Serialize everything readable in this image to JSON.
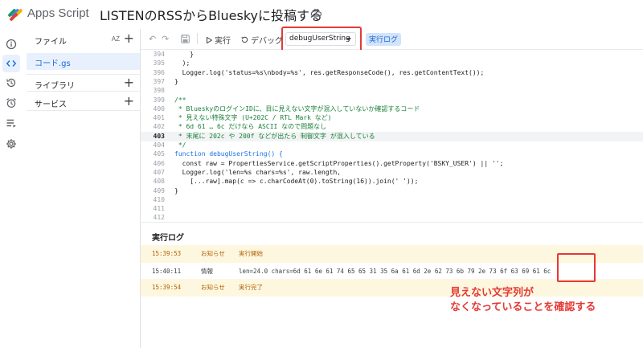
{
  "header": {
    "app_name": "Apps Script",
    "project_title": "LISTENのRSSからBlueskyに投稿する"
  },
  "rail": {
    "items": [
      {
        "icon": "info-icon"
      },
      {
        "icon": "code-icon",
        "active": true
      },
      {
        "icon": "history-icon"
      },
      {
        "icon": "alarm-icon"
      },
      {
        "icon": "executions-icon"
      },
      {
        "icon": "settings-icon"
      }
    ]
  },
  "panel": {
    "files_label": "ファイル",
    "sort_label": "AZ",
    "file_name": "コード.gs",
    "libraries_label": "ライブラリ",
    "services_label": "サービス",
    "plus": "+"
  },
  "toolbar": {
    "run_label": "実行",
    "debug_label": "デバッグ",
    "function_selected": "debugUserString",
    "log_toggle_label": "実行ログ"
  },
  "code_lines": [
    {
      "num": "394",
      "text": "    }",
      "cls": ""
    },
    {
      "num": "395",
      "text": "  );",
      "cls": ""
    },
    {
      "num": "396",
      "text": "  Logger.log('status=%s\\nbody=%s', res.getResponseCode(), res.getContentText());",
      "cls": ""
    },
    {
      "num": "397",
      "text": "}",
      "cls": ""
    },
    {
      "num": "398",
      "text": "",
      "cls": ""
    },
    {
      "num": "399",
      "text": "/**",
      "cls": "comment"
    },
    {
      "num": "400",
      "text": " * BlueskyのログインIDに、目に見えない文字が混入していないか確認するコード",
      "cls": "comment"
    },
    {
      "num": "401",
      "text": " * 見えない特殊文字 (U+202C / RTL Mark など)",
      "cls": "comment"
    },
    {
      "num": "402",
      "text": " * 6d 61 … 6c だけなら ASCII なので問題なし",
      "cls": "comment"
    },
    {
      "num": "403",
      "text": " * 末尾に 202c や 200f などが出たら 制御文字 が混入している",
      "cls": "comment",
      "current": true
    },
    {
      "num": "404",
      "text": " */",
      "cls": "comment"
    },
    {
      "num": "405",
      "text": "function debugUserString() {",
      "cls": "plain"
    },
    {
      "num": "406",
      "text": "  const raw = PropertiesService.getScriptProperties().getProperty('BSKY_USER') || '';",
      "cls": ""
    },
    {
      "num": "407",
      "text": "  Logger.log('len=%s chars=%s', raw.length,",
      "cls": ""
    },
    {
      "num": "408",
      "text": "    [...raw].map(c => c.charCodeAt(0).toString(16)).join(' '));",
      "cls": ""
    },
    {
      "num": "409",
      "text": "}",
      "cls": ""
    },
    {
      "num": "410",
      "text": "",
      "cls": ""
    },
    {
      "num": "411",
      "text": "",
      "cls": ""
    },
    {
      "num": "412",
      "text": "",
      "cls": ""
    }
  ],
  "log": {
    "title": "実行ログ",
    "rows": [
      {
        "time": "15:39:53",
        "level": "お知らせ",
        "message": "実行開始",
        "type": "notice"
      },
      {
        "time": "15:40:11",
        "level": "情報",
        "message": "len=24.0 chars=6d 61 6e 61 74 65 65 31 35 6a 61 6d 2e 62 73 6b 79 2e 73 6f 63 69 61 6c",
        "type": "info"
      },
      {
        "time": "15:39:54",
        "level": "お知らせ",
        "message": "実行完了",
        "type": "notice"
      }
    ]
  },
  "annotation": {
    "line1": "見えない文字列が",
    "line2": "なくなっていることを確認する"
  },
  "colors": {
    "accent": "#1a73e8",
    "highlight_red": "#e53935",
    "notice_bg": "#fef7e0"
  }
}
